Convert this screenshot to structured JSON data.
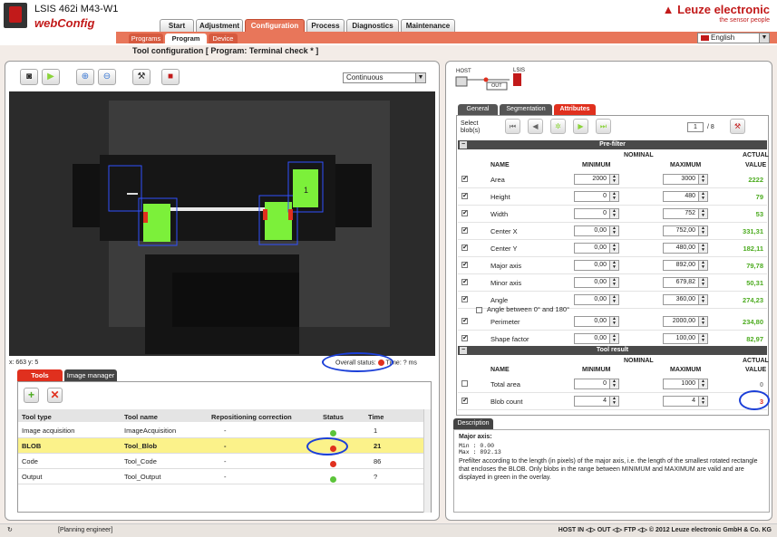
{
  "header": {
    "device_title": "LSIS 462i M43-W1",
    "app_name": "webConfig",
    "brand": "Leuze electronic",
    "tagline": "the sensor people",
    "language": "English",
    "main_tabs": [
      "Start",
      "Adjustment",
      "Configuration",
      "Process",
      "Diagnostics",
      "Maintenance"
    ],
    "active_main_tab": "Configuration",
    "sub_tabs": [
      "Programs",
      "Program",
      "Device"
    ],
    "active_sub_tab": "Program"
  },
  "page_title": "Tool configuration   [ Program: Terminal check * ]",
  "toolbar": {
    "mode_select": "Continuous",
    "icons": [
      "camera-icon",
      "play-icon",
      "zoom-in-icon",
      "zoom-out-icon",
      "wrench-icon",
      "program-icon"
    ]
  },
  "image_footer": {
    "coords": "x: 663 y: 5",
    "overall_status_label": "Overall status:",
    "time_label": "Time: ? ms"
  },
  "tools_panel": {
    "tabs": [
      "Tools",
      "Image manager"
    ],
    "columns": [
      "Tool type",
      "Tool name",
      "Repositioning correction",
      "Status",
      "Time"
    ],
    "rows": [
      {
        "type": "Image acquisition",
        "name": "ImageAcquisition",
        "repos": "-",
        "status": "green",
        "time": "1"
      },
      {
        "type": "BLOB",
        "name": "Tool_Blob",
        "repos": "-",
        "status": "red",
        "time": "21"
      },
      {
        "type": "Code",
        "name": "Tool_Code",
        "repos": "-",
        "status": "red",
        "time": "86"
      },
      {
        "type": "Output",
        "name": "Tool_Output",
        "repos": "-",
        "status": "green",
        "time": "?"
      }
    ]
  },
  "right_panel": {
    "diagram": {
      "host": "HOST",
      "lsis": "LSIS",
      "out": "OUT"
    },
    "tabs": [
      "General",
      "Segmentation",
      "Attributes"
    ],
    "active_tab": "Attributes",
    "select_blobs_label": "Select blob(s)",
    "blob_page": "1",
    "blob_total": "/ 8",
    "prefilter": {
      "title": "Pre-filter",
      "nominal": "NOMINAL",
      "actual": "ACTUAL",
      "value": "VALUE",
      "name_col": "NAME",
      "min_col": "MINIMUM",
      "max_col": "MAXIMUM",
      "rows": [
        {
          "name": "Area",
          "min": "2000",
          "max": "3000",
          "actual": "2222"
        },
        {
          "name": "Height",
          "min": "0",
          "max": "480",
          "actual": "79"
        },
        {
          "name": "Width",
          "min": "0",
          "max": "752",
          "actual": "53"
        },
        {
          "name": "Center X",
          "min": "0,00",
          "max": "752,00",
          "actual": "331,31"
        },
        {
          "name": "Center Y",
          "min": "0,00",
          "max": "480,00",
          "actual": "182,11"
        },
        {
          "name": "Major axis",
          "min": "0,00",
          "max": "892,00",
          "actual": "79,78"
        },
        {
          "name": "Minor axis",
          "min": "0,00",
          "max": "679,82",
          "actual": "50,31"
        },
        {
          "name": "Angle",
          "min": "0,00",
          "max": "360,00",
          "actual": "274,23"
        }
      ],
      "angle_option": "Angle between 0° and 180°",
      "rows2": [
        {
          "name": "Perimeter",
          "min": "0,00",
          "max": "2000,00",
          "actual": "234,80"
        },
        {
          "name": "Shape factor",
          "min": "0,00",
          "max": "100,00",
          "actual": "82,97"
        }
      ]
    },
    "tool_result": {
      "title": "Tool result",
      "rows": [
        {
          "name": "Total area",
          "min": "0",
          "max": "1000",
          "actual": "0"
        },
        {
          "name": "Blob count",
          "min": "4",
          "max": "4",
          "actual": "3"
        }
      ]
    },
    "description": {
      "tab": "Description",
      "title": "Major axis:",
      "min_line": "Min : 0.00",
      "max_line": "Max : 892.13",
      "text": "Prefilter according to the length (in pixels) of the major axis, i.e. the length of the smallest rotated rectangle that encloses the BLOB. Only blobs in the range between MINIMUM and MAXIMUM are valid and are displayed in green in the overlay."
    }
  },
  "statusbar": {
    "user": "[Planning engineer]",
    "right": "HOST IN ◁▷ OUT ◁▷ FTP ◁▷   © 2012 Leuze electronic GmbH & Co. KG"
  },
  "colors": {
    "accent": "#e8765a",
    "brand_red": "#c21a1a",
    "ok_green": "#4cab1f",
    "fail_red": "#e0301e",
    "highlight": "#1b3fd8"
  }
}
